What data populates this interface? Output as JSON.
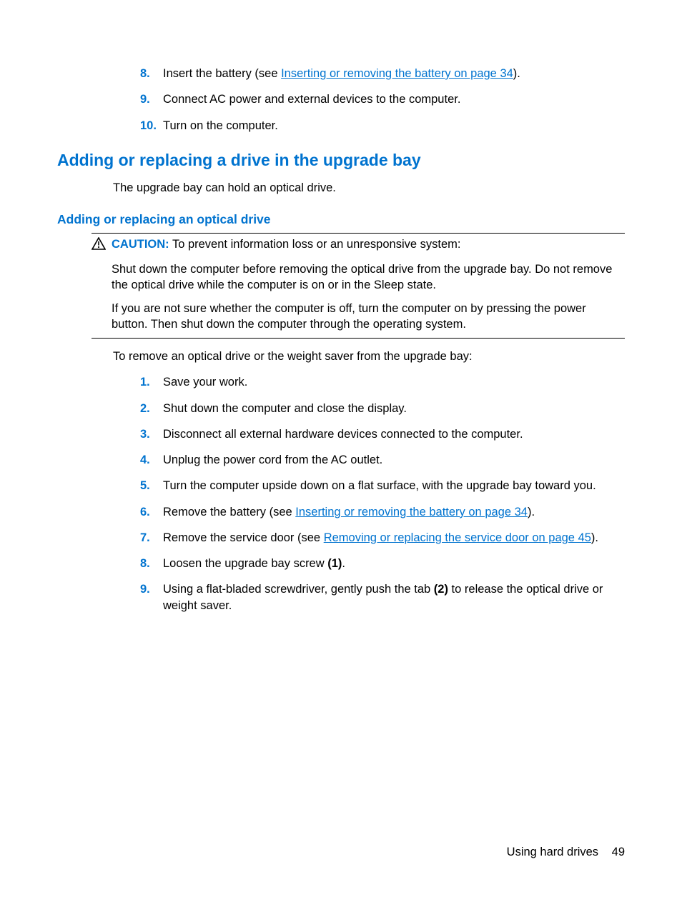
{
  "top_steps": [
    {
      "num": "8.",
      "pre": "Insert the battery (see ",
      "link": "Inserting or removing the battery on page 34",
      "post": ")."
    },
    {
      "num": "9.",
      "text": "Connect AC power and external devices to the computer."
    },
    {
      "num": "10.",
      "text": "Turn on the computer."
    }
  ],
  "section_title": "Adding or replacing a drive in the upgrade bay",
  "section_intro": "The upgrade bay can hold an optical drive.",
  "subsection_title": "Adding or replacing an optical drive",
  "caution": {
    "label": "CAUTION:",
    "head_rest": "   To prevent information loss or an unresponsive system:",
    "p1": "Shut down the computer before removing the optical drive from the upgrade bay. Do not remove the optical drive while the computer is on or in the Sleep state.",
    "p2": "If you are not sure whether the computer is off, turn the computer on by pressing the power button. Then shut down the computer through the operating system."
  },
  "post_caution": "To remove an optical drive or the weight saver from the upgrade bay:",
  "steps": [
    {
      "num": "1.",
      "text": "Save your work."
    },
    {
      "num": "2.",
      "text": "Shut down the computer and close the display."
    },
    {
      "num": "3.",
      "text": "Disconnect all external hardware devices connected to the computer."
    },
    {
      "num": "4.",
      "text": "Unplug the power cord from the AC outlet."
    },
    {
      "num": "5.",
      "text": "Turn the computer upside down on a flat surface, with the upgrade bay toward you."
    },
    {
      "num": "6.",
      "pre": "Remove the battery (see ",
      "link": "Inserting or removing the battery on page 34",
      "post": ")."
    },
    {
      "num": "7.",
      "pre": "Remove the service door (see ",
      "link": "Removing or replacing the service door on page 45",
      "post": ")."
    },
    {
      "num": "8.",
      "segments": [
        {
          "t": "Loosen the upgrade bay screw "
        },
        {
          "t": "(1)",
          "bold": true
        },
        {
          "t": "."
        }
      ]
    },
    {
      "num": "9.",
      "segments": [
        {
          "t": "Using a flat-bladed screwdriver, gently push the tab "
        },
        {
          "t": "(2)",
          "bold": true
        },
        {
          "t": " to release the optical drive or weight saver."
        }
      ]
    }
  ],
  "footer": {
    "label": "Using hard drives",
    "page": "49"
  }
}
